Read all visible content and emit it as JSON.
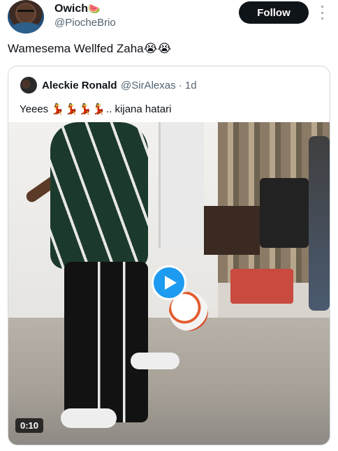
{
  "author": {
    "display_name": "Owich",
    "display_emoji": "🍉",
    "handle": "@PiocheBrio",
    "avatar_icon": "avatar"
  },
  "follow_button": {
    "label": "Follow"
  },
  "more_icon": "more-vertical-icon",
  "tweet": {
    "text": "Wamesema Wellfed Zaha😭😭"
  },
  "quote": {
    "name": "Aleckie Ronald",
    "handle_time": "@SirAlexas · 1d",
    "text_prefix": "Yeees ",
    "text_emojis": "💃💃💃💃",
    "text_suffix": ".. kijana hatari",
    "video": {
      "duration": "0:10",
      "play_icon": "play-icon"
    }
  },
  "colors": {
    "follow_bg": "#0f1419",
    "play_bg": "#1d9bf0",
    "secondary_text": "#536471",
    "card_border": "#cfd9de"
  }
}
